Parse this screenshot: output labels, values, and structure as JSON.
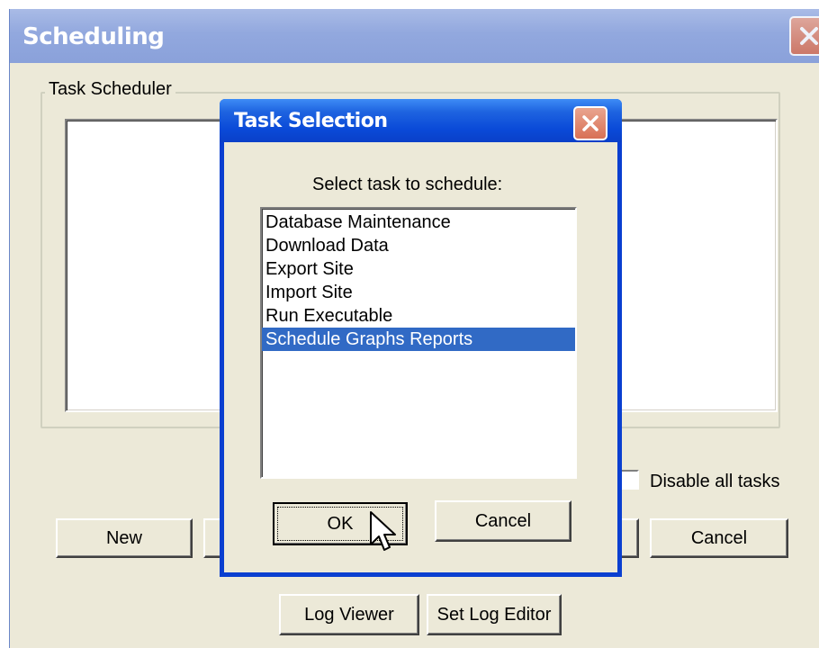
{
  "window": {
    "title": "Scheduling",
    "group_label": "Task Scheduler",
    "disable_all_label": "Disable all tasks",
    "buttons": {
      "new": "New",
      "cancel": "Cancel",
      "log_viewer": "Log Viewer",
      "set_log_editor": "Set Log Editor"
    }
  },
  "dialog": {
    "title": "Task Selection",
    "prompt": "Select task to schedule:",
    "tasks": [
      "Database Maintenance",
      "Download Data",
      "Export Site",
      "Import Site",
      "Run Executable",
      "Schedule Graphs Reports"
    ],
    "selected_task": "Schedule Graphs Reports",
    "ok_label": "OK",
    "cancel_label": "Cancel"
  },
  "icons": {
    "close": "close-x-icon",
    "cursor": "mouse-pointer-icon"
  },
  "colors": {
    "selection": "#316ac5",
    "dialog_title": "#0a4ad8",
    "inactive_title": "#8aa1da",
    "close_button": "#d87155"
  }
}
